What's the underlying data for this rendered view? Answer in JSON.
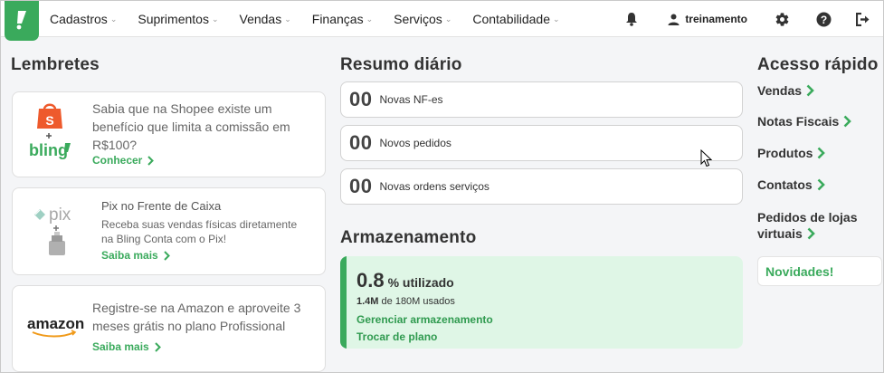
{
  "colors": {
    "brand": "#3aaa5c",
    "storage_bg": "#dff6e6",
    "link": "#3aaa5c"
  },
  "nav": {
    "logo_icon": "bling-logo-icon",
    "items": [
      {
        "label": "Cadastros"
      },
      {
        "label": "Suprimentos"
      },
      {
        "label": "Vendas"
      },
      {
        "label": "Finanças"
      },
      {
        "label": "Serviços"
      },
      {
        "label": "Contabilidade"
      }
    ],
    "user": "treinamento",
    "icons": [
      "bell-icon",
      "user-icon",
      "gear-icon",
      "help-icon",
      "logout-icon"
    ]
  },
  "lembretes": {
    "title": "Lembretes",
    "cards": [
      {
        "text": "Sabia que na Shopee existe um benefício que limita a comissão em R$100?",
        "link": "Conhecer",
        "logo_text": "bling",
        "plus": "+"
      },
      {
        "title": "Pix no Frente de Caixa",
        "text": "Receba suas vendas físicas diretamente na Bling Conta com o Pix!",
        "link": "Saiba mais",
        "logo_text": "pix",
        "plus": "+"
      },
      {
        "text": "Registre-se na Amazon e aproveite 3 meses grátis no plano Profissional",
        "link": "Saiba mais",
        "logo_text": "amazon"
      }
    ]
  },
  "resumo": {
    "title": "Resumo diário",
    "items": [
      {
        "count": "00",
        "label": "Novas NF-es"
      },
      {
        "count": "00",
        "label": "Novos pedidos"
      },
      {
        "count": "00",
        "label": "Novas ordens serviços"
      }
    ]
  },
  "armazenamento": {
    "title": "Armazenamento",
    "percent": "0.8",
    "percent_unit": "% utilizado",
    "used": "1.4M",
    "used_suffix": "de 180M usados",
    "manage": "Gerenciar armazenamento",
    "change_plan": "Trocar de plano"
  },
  "acesso": {
    "title": "Acesso rápido",
    "links": [
      {
        "label": "Vendas"
      },
      {
        "label": "Notas Fiscais"
      },
      {
        "label": "Produtos"
      },
      {
        "label": "Contatos"
      },
      {
        "label": "Pedidos de lojas virtuais"
      }
    ],
    "novidades": "Novidades!"
  }
}
